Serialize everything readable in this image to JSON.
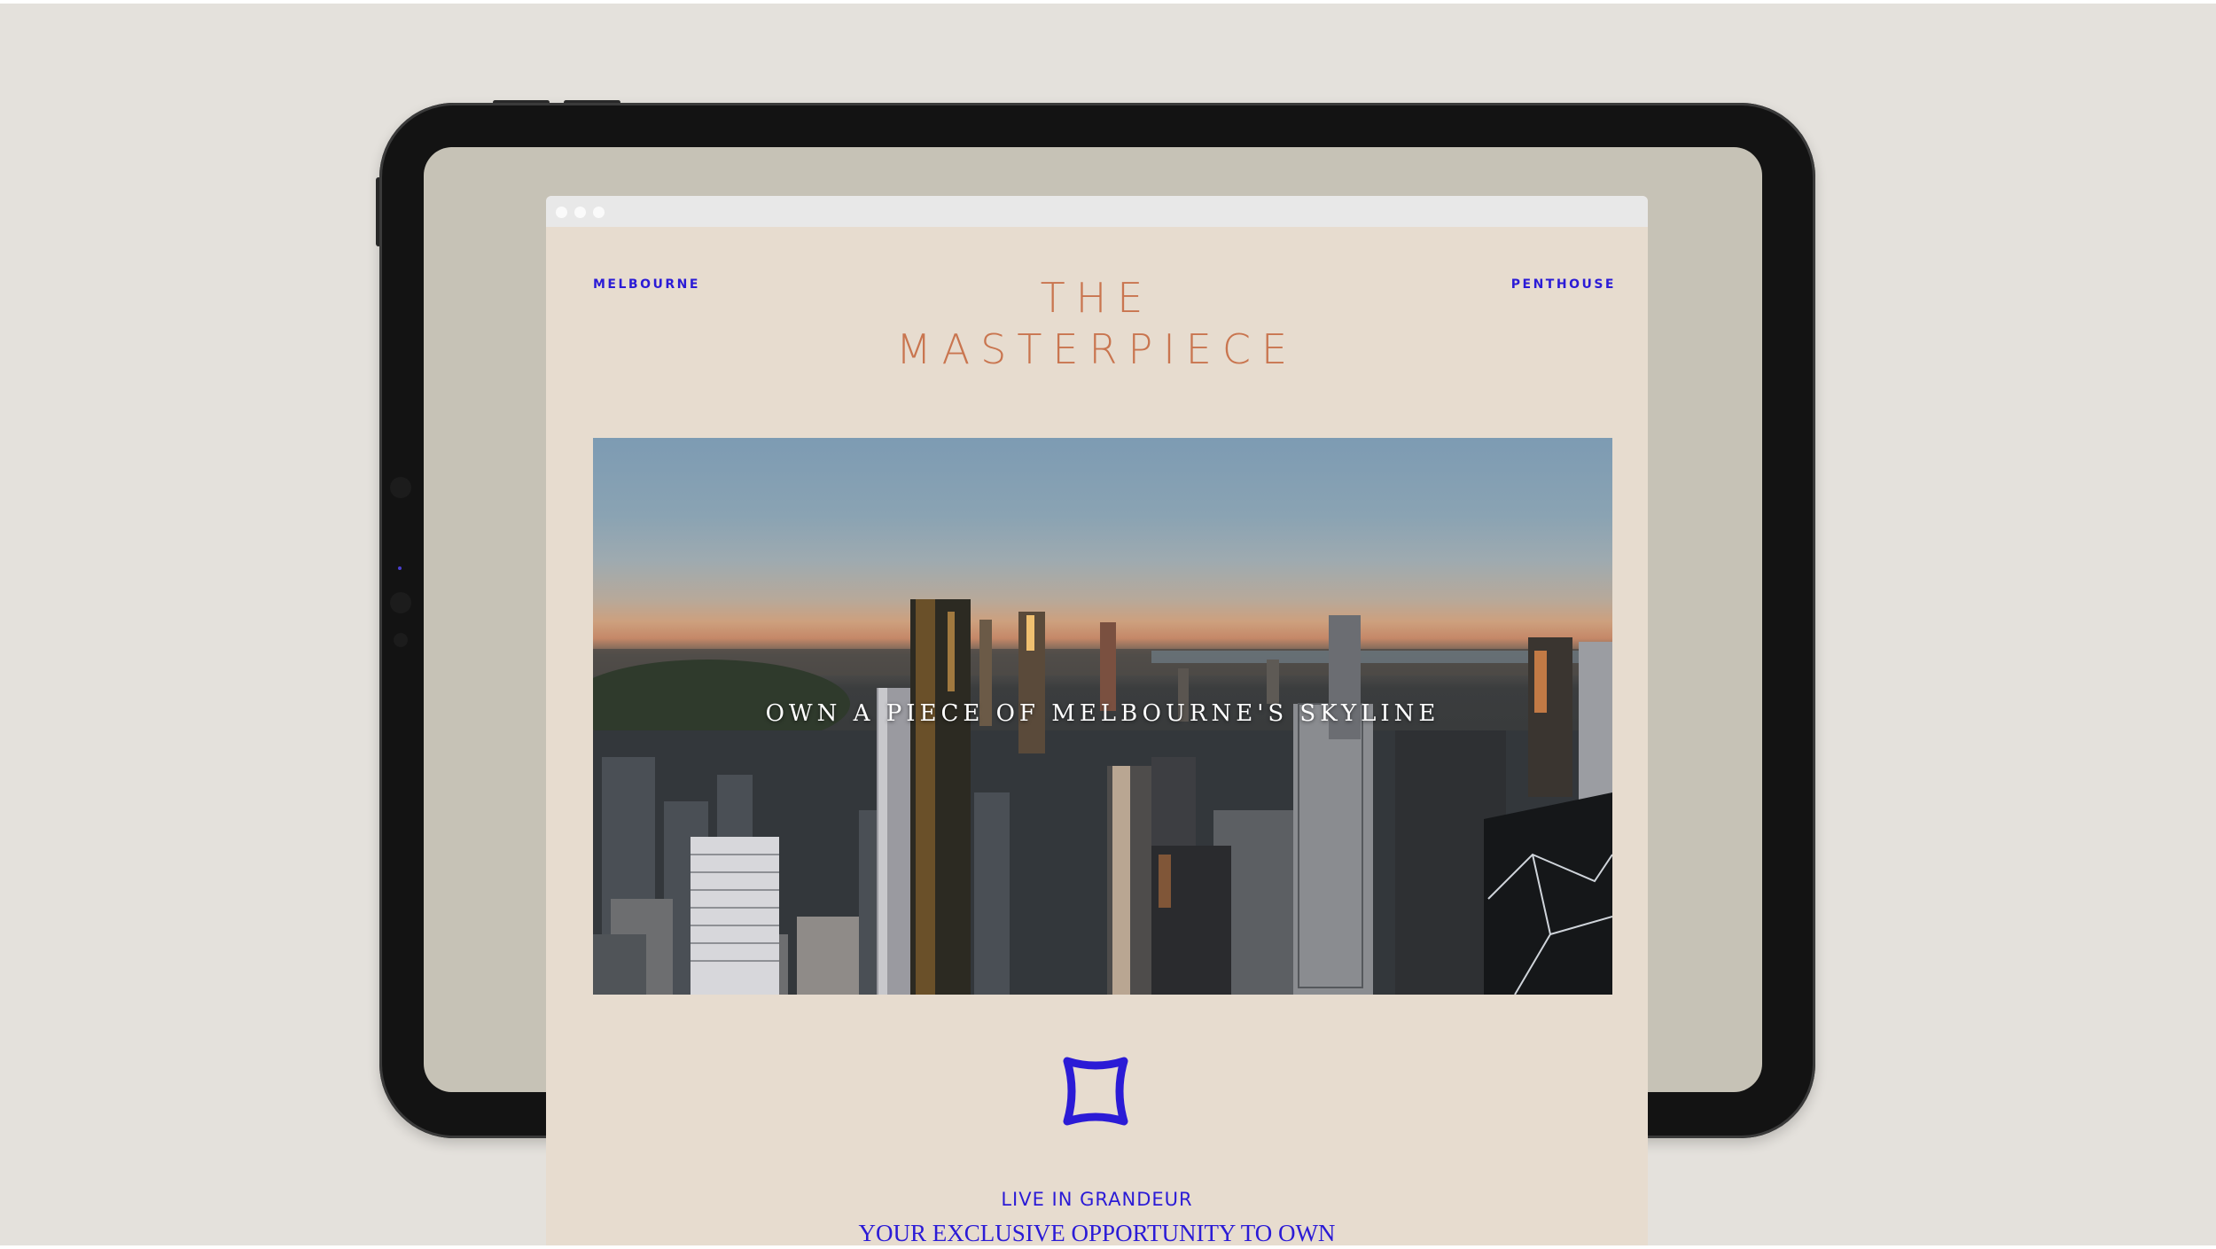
{
  "site": {
    "nav_left": "MELBOURNE",
    "nav_right": "PENTHOUSE",
    "brand_line1": "THE",
    "brand_line2": "MASTERPIECE",
    "hero_caption": "OWN A PIECE OF MELBOURNE'S SKYLINE",
    "emblem_icon": "star-shape-icon",
    "section_kicker": "LIVE IN GRANDEUR",
    "section_heading": "YOUR EXCLUSIVE OPPORTUNITY TO OWN"
  },
  "colors": {
    "accent": "#2b1bd6",
    "brand_copper": "#c9754f",
    "page_background": "#e7dccf",
    "backdrop": "#e4e1dc",
    "tablet_bezel": "#131313",
    "tablet_screen": "#c6c2b6"
  }
}
